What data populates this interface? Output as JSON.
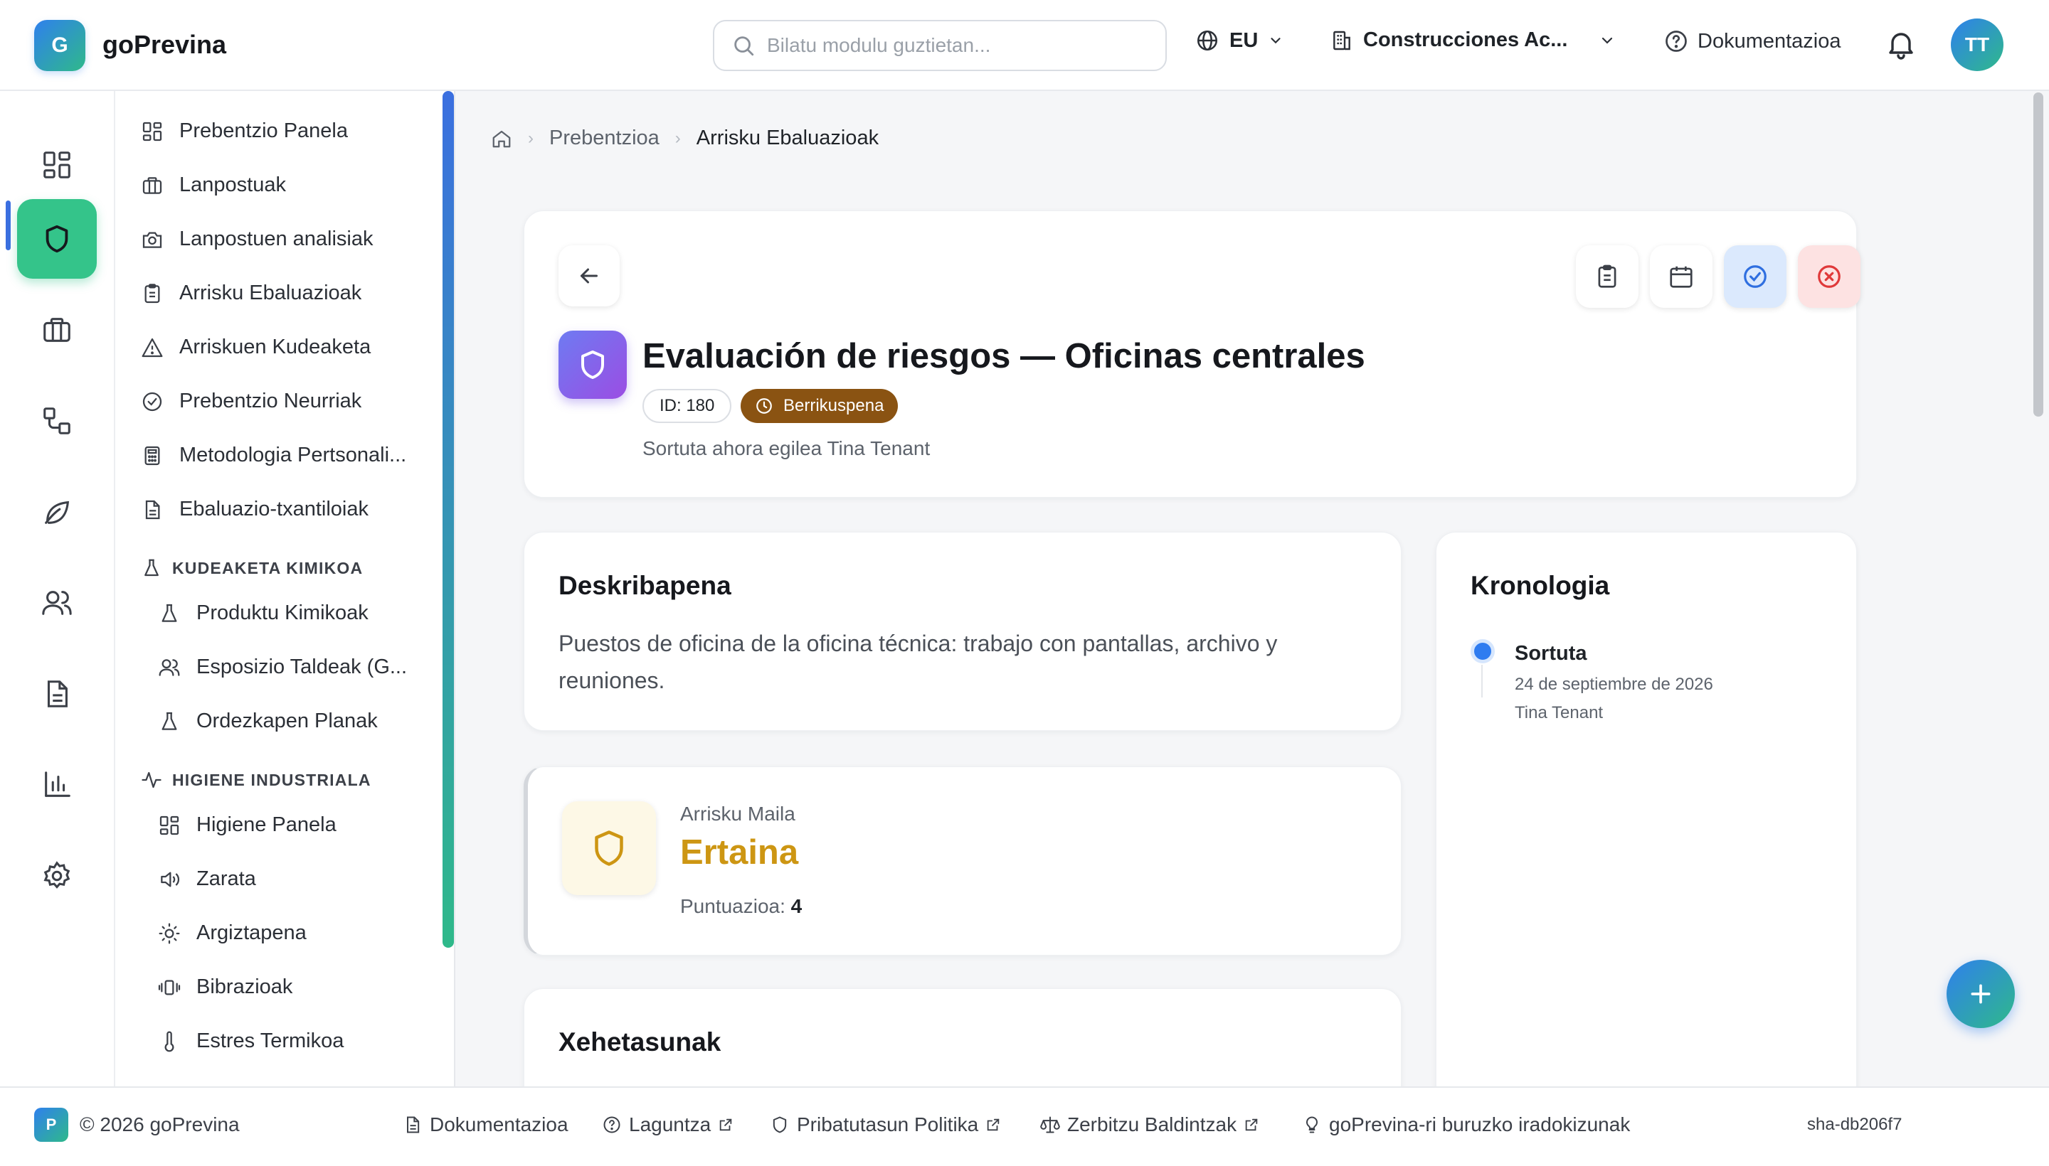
{
  "header": {
    "logo_letter": "G",
    "app_name": "goPrevina",
    "search_placeholder": "Bilatu modulu guztietan...",
    "language": "EU",
    "company": "Construcciones Ac...",
    "docs_label": "Dokumentazioa",
    "avatar_initials": "TT"
  },
  "rail": {
    "items": [
      {
        "icon": "dashboard-icon"
      },
      {
        "icon": "shield-icon",
        "active": true
      },
      {
        "icon": "briefcase-icon"
      },
      {
        "icon": "workflow-icon"
      },
      {
        "icon": "leaf-icon"
      },
      {
        "icon": "users-icon"
      },
      {
        "icon": "document-icon"
      },
      {
        "icon": "bar-chart-icon"
      },
      {
        "icon": "settings-icon"
      }
    ]
  },
  "sidebar": {
    "items": [
      {
        "label": "Prebentzio Panela",
        "icon": "dashboard-icon"
      },
      {
        "label": "Lanpostuak",
        "icon": "briefcase-icon"
      },
      {
        "label": "Lanpostuen analisiak",
        "icon": "camera-icon"
      },
      {
        "label": "Arrisku Ebaluazioak",
        "icon": "clipboard-icon"
      },
      {
        "label": "Arriskuen Kudeaketa",
        "icon": "warning-icon"
      },
      {
        "label": "Prebentzio Neurriak",
        "icon": "check-circle-icon"
      },
      {
        "label": "Metodologia Pertsonali...",
        "icon": "calculator-icon"
      },
      {
        "label": "Ebaluazio-txantiloiak",
        "icon": "file-icon"
      }
    ],
    "section_chemical": "KUDEAKETA KIMIKOA",
    "chemical_items": [
      {
        "label": "Produktu Kimikoak",
        "icon": "flask-icon"
      },
      {
        "label": "Esposizio Taldeak (G...",
        "icon": "users-icon"
      },
      {
        "label": "Ordezkapen Planak",
        "icon": "flask-icon"
      }
    ],
    "section_hygiene": "HIGIENE INDUSTRIALA",
    "hygiene_items": [
      {
        "label": "Higiene Panela",
        "icon": "dashboard-icon"
      },
      {
        "label": "Zarata",
        "icon": "speaker-icon"
      },
      {
        "label": "Argiztapena",
        "icon": "sun-icon"
      },
      {
        "label": "Bibrazioak",
        "icon": "vibration-icon"
      },
      {
        "label": "Estres Termikoa",
        "icon": "thermometer-icon"
      }
    ]
  },
  "breadcrumb": {
    "parent": "Prebentzioa",
    "current": "Arrisku Ebaluazioak"
  },
  "assessment": {
    "title": "Evaluación de riesgos — Oficinas centrales",
    "id_label": "ID: 180",
    "status": "Berrikuspena",
    "created_text": "Sortuta ahora egilea Tina Tenant"
  },
  "description": {
    "title": "Deskribapena",
    "text": "Puestos de oficina de la oficina técnica: trabajo con pantallas, archivo y reuniones."
  },
  "risk": {
    "label": "Arrisku Maila",
    "level": "Ertaina",
    "score_label": "Puntuazioa:",
    "score_value": "4",
    "color": "#cd9613"
  },
  "details": {
    "title": "Xehetasunak"
  },
  "timeline": {
    "title": "Kronologia",
    "events": [
      {
        "title": "Sortuta",
        "date": "24 de septiembre de 2026",
        "user": "Tina Tenant"
      }
    ]
  },
  "footer": {
    "logo_letter": "P",
    "copyright": "© 2026 goPrevina",
    "docs": "Dokumentazioa",
    "help": "Laguntza",
    "privacy": "Pribatutasun Politika",
    "terms": "Zerbitzu Baldintzak",
    "suggestions": "goPrevina-ri buruzko iradokizunak",
    "sha": "sha-db206f7"
  },
  "colors": {
    "accent": "#2f80ed",
    "accent_green": "#34c48a",
    "status_brown": "#8a5312",
    "risk_medium": "#cd9613"
  }
}
